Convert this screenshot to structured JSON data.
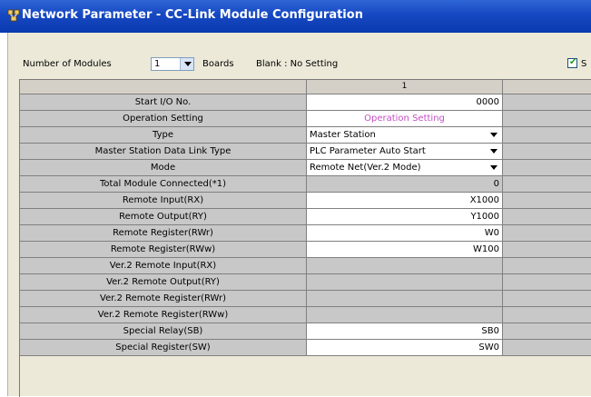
{
  "window": {
    "title": "Network Parameter - CC-Link Module Configuration"
  },
  "toolbar": {
    "modules_label": "Number of Modules",
    "modules_value": "1",
    "boards_label": "Boards",
    "blank_hint": "Blank : No Setting",
    "checkbox_label": "S",
    "checkbox_checked": true
  },
  "grid": {
    "column_header": "1",
    "rows": [
      {
        "label": "Start I/O No.",
        "value": "0000",
        "style": "white",
        "align": "right"
      },
      {
        "label": "Operation Setting",
        "value": "Operation Setting",
        "style": "white",
        "align": "center"
      },
      {
        "label": "Type",
        "value": "Master Station",
        "style": "white",
        "align": "left",
        "dropdown": true
      },
      {
        "label": "Master Station Data Link Type",
        "value": "PLC Parameter Auto Start",
        "style": "white",
        "align": "left",
        "dropdown": true
      },
      {
        "label": "Mode",
        "value": "Remote Net(Ver.2 Mode)",
        "style": "white",
        "align": "left",
        "dropdown": true
      },
      {
        "label": "Total Module Connected(*1)",
        "value": "0",
        "style": "gray",
        "align": "right"
      },
      {
        "label": "Remote Input(RX)",
        "value": "X1000",
        "style": "white",
        "align": "right"
      },
      {
        "label": "Remote Output(RY)",
        "value": "Y1000",
        "style": "white",
        "align": "right"
      },
      {
        "label": "Remote Register(RWr)",
        "value": "W0",
        "style": "white",
        "align": "right"
      },
      {
        "label": "Remote Register(RWw)",
        "value": "W100",
        "style": "white",
        "align": "right"
      },
      {
        "label": "Ver.2 Remote Input(RX)",
        "value": "",
        "style": "gray",
        "align": "right"
      },
      {
        "label": "Ver.2 Remote Output(RY)",
        "value": "",
        "style": "gray",
        "align": "right"
      },
      {
        "label": "Ver.2 Remote Register(RWr)",
        "value": "",
        "style": "gray",
        "align": "right"
      },
      {
        "label": "Ver.2 Remote Register(RWw)",
        "value": "",
        "style": "gray",
        "align": "right"
      },
      {
        "label": "Special Relay(SB)",
        "value": "SB0",
        "style": "white",
        "align": "right"
      },
      {
        "label": "Special Register(SW)",
        "value": "SW0",
        "style": "white",
        "align": "right"
      }
    ]
  },
  "colors": {
    "title_bar": "#1648c2",
    "window_bg": "#ece9d8",
    "cell_gray": "#c8c8c8",
    "operation_setting_text": "#c44fc4"
  }
}
